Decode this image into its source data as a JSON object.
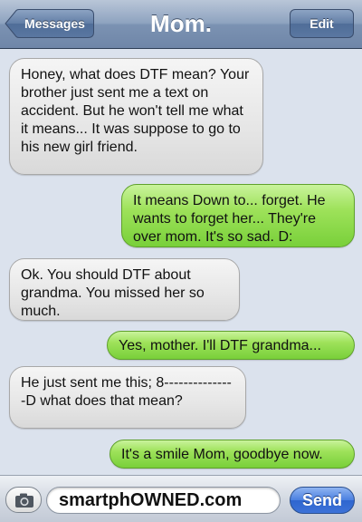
{
  "header": {
    "title": "Mom.",
    "back_label": "Messages",
    "edit_label": "Edit"
  },
  "messages": [
    {
      "direction": "received",
      "text": "Honey, what does DTF mean? Your brother just sent me a text on accident. But he won't tell me what it means... It was suppose to go to his new girl friend."
    },
    {
      "direction": "sent",
      "text": "It means Down to... forget. He wants to forget her... They're over mom. It's so sad. D:"
    },
    {
      "direction": "received",
      "text": "Ok. You should DTF about grandma. You missed her so much."
    },
    {
      "direction": "sent",
      "text": "Yes, mother. I'll DTF grandma..."
    },
    {
      "direction": "received",
      "text": "He just sent me this; 8---------------D what does that mean?"
    },
    {
      "direction": "sent",
      "text": "It's a smile Mom, goodbye now."
    }
  ],
  "compose": {
    "field_value": "smartphOWNED.com",
    "send_label": "Send",
    "camera_icon": "camera-icon"
  },
  "colors": {
    "sent_bubble": "#9ee25a",
    "received_bubble": "#e6e6e6",
    "nav_bar": "#8ea3bf",
    "background": "#dbe2ed",
    "send_button": "#3c72d8"
  }
}
